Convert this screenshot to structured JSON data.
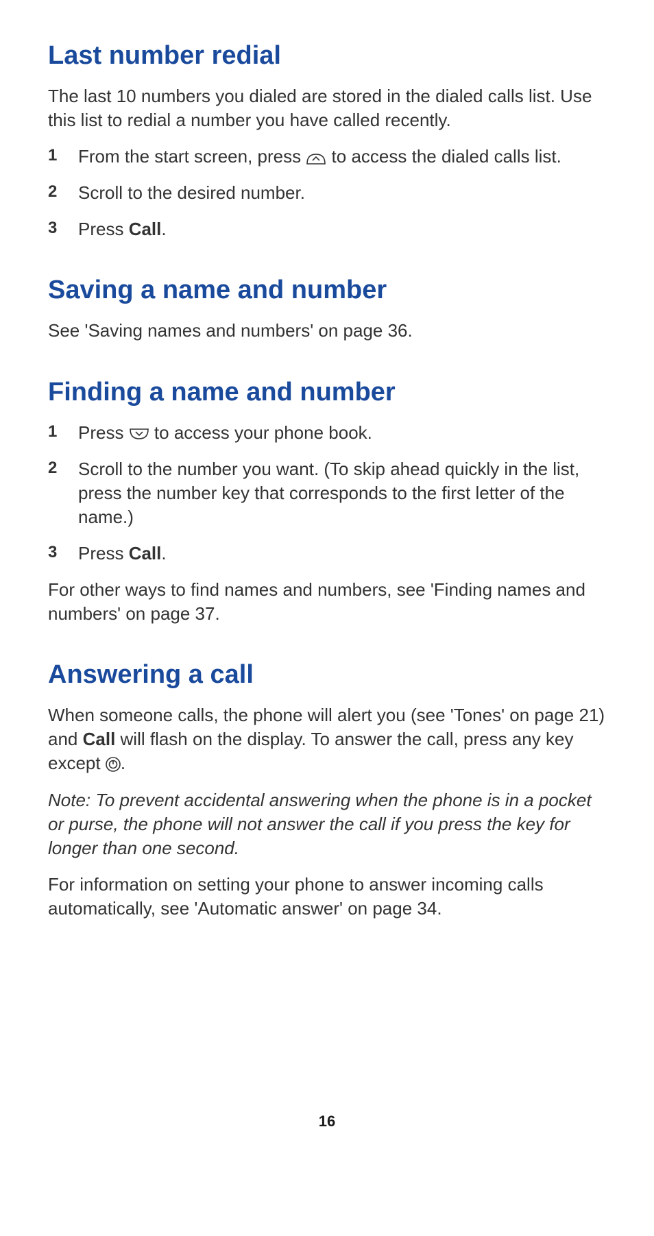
{
  "s1": {
    "h": "Last number redial",
    "p1": "The last 10 numbers you dialed are stored in the dialed calls list. Use this list to redial a number you have called recently.",
    "li1a": "From the start screen, press ",
    "li1b": " to access the dialed calls list.",
    "li2": "Scroll to the desired number.",
    "li3a": "Press ",
    "li3b": "Call",
    "li3c": "."
  },
  "s2": {
    "h": "Saving a name and number",
    "p1": "See 'Saving names and numbers' on page 36."
  },
  "s3": {
    "h": "Finding a name and number",
    "li1a": "Press ",
    "li1b": " to access your phone book.",
    "li2": "Scroll to the number you want. (To skip ahead quickly in the list, press the number key that corresponds to the first letter of the name.)",
    "li3a": "Press ",
    "li3b": "Call",
    "li3c": ".",
    "p1": "For other ways to find names and numbers, see 'Finding names and numbers' on page 37."
  },
  "s4": {
    "h": "Answering a call",
    "p1a": "When someone calls, the phone will alert you (see 'Tones' on page 21) and ",
    "p1b": "Call",
    "p1c": " will flash on the display. To answer the call, press any key except ",
    "p1d": ".",
    "note": "Note:  To prevent accidental answering when the phone is in a pocket or purse, the phone will not answer the call if you press the key for longer than one second.",
    "p2": "For information on setting your phone to answer incoming calls automatically, see 'Automatic answer' on page 34."
  },
  "nums": {
    "n1": "1",
    "n2": "2",
    "n3": "3"
  },
  "page": "16"
}
